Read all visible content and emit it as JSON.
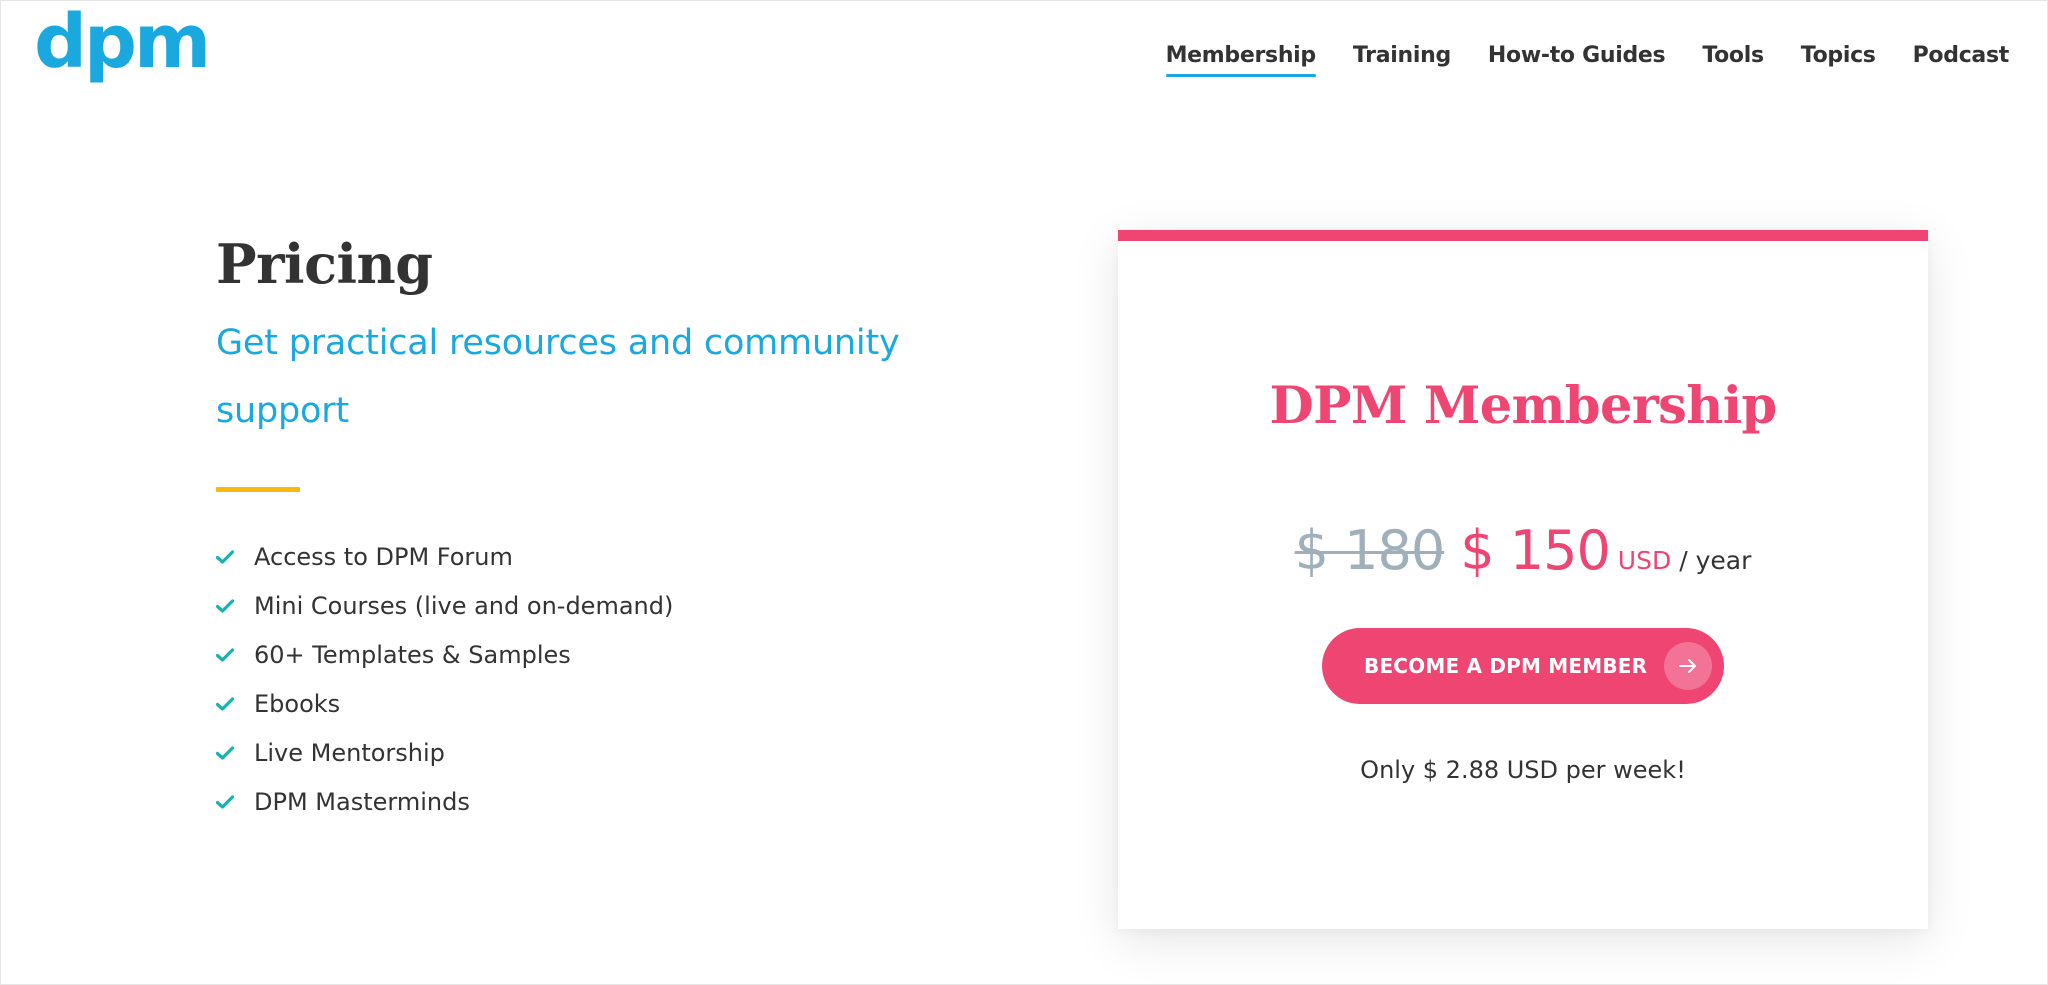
{
  "header": {
    "logo_text": "dpm",
    "nav": [
      {
        "label": "Membership",
        "active": true
      },
      {
        "label": "Training",
        "active": false
      },
      {
        "label": "How-to Guides",
        "active": false
      },
      {
        "label": "Tools",
        "active": false
      },
      {
        "label": "Topics",
        "active": false
      },
      {
        "label": "Podcast",
        "active": false
      }
    ]
  },
  "intro": {
    "title": "Pricing",
    "subtitle": "Get practical resources and community support",
    "benefits": [
      "Access to DPM Forum",
      "Mini Courses (live and on-demand)",
      "60+ Templates & Samples",
      "Ebooks",
      "Live Mentorship",
      "DPM Masterminds"
    ]
  },
  "card": {
    "plan_name": "DPM Membership",
    "old_price": "$ 180",
    "new_price": "$ 150",
    "currency": "USD",
    "period": "/ year",
    "cta_label": "BECOME A DPM MEMBER",
    "cta_icon": "arrow-right-icon",
    "weekly_note": "Only $ 2.88 USD per week!"
  },
  "colors": {
    "brand_blue": "#1aa9df",
    "accent_pink": "#ee4572",
    "accent_yellow": "#f9b911",
    "check_teal": "#16b3b3",
    "strike_gray": "#9fb0bb",
    "text_dark": "#333333"
  }
}
